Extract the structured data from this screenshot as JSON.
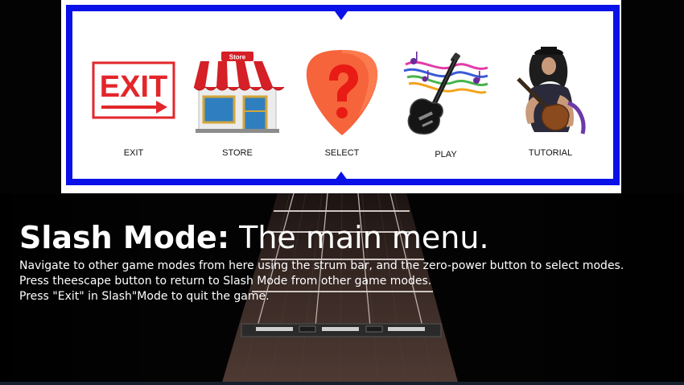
{
  "menu": {
    "items": [
      {
        "id": "exit",
        "label": "EXIT",
        "icon": "exit-sign-icon"
      },
      {
        "id": "store",
        "label": "STORE",
        "icon": "store-icon",
        "sign_text": "Store"
      },
      {
        "id": "select",
        "label": "SELECT",
        "icon": "question-pick-icon"
      },
      {
        "id": "play",
        "label": "PLAY",
        "icon": "guitar-notes-icon"
      },
      {
        "id": "tutorial",
        "label": "TUTORIAL",
        "icon": "guitarist-icon"
      }
    ],
    "exit_sign_text": "EXIT",
    "frame_color": "#0a10e8"
  },
  "info": {
    "title_bold": "Slash Mode:",
    "title_rest": "The main menu.",
    "lines": [
      "Navigate to other game modes from here using the strum bar, and the zero-power button to select modes.",
      "Press theescape button to return to Slash Mode from other game modes.",
      "Press \"Exit\" in Slash\"Mode to quit the game."
    ]
  },
  "colors": {
    "background": "#030303",
    "exit_red": "#e3262a",
    "awning_red": "#d42026",
    "pick_orange": "#f6643c",
    "question_red": "#e81c14"
  }
}
